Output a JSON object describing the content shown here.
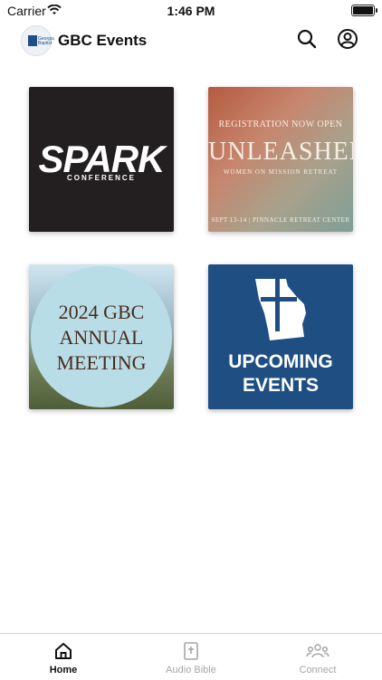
{
  "status": {
    "carrier": "Carrier",
    "time": "1:46 PM"
  },
  "header": {
    "title": "GBC Events",
    "logo_text": "Georgia Baptist"
  },
  "tiles": [
    {
      "title": "SPARK",
      "subtitle": "CONFERENCE"
    },
    {
      "top": "REGISTRATION NOW OPEN",
      "title": "UNLEASHED",
      "subtitle": "WOMEN ON MISSION RETREAT",
      "date": "SEPT 13-14 | PINNACLE RETREAT CENTER"
    },
    {
      "line1": "2024 GBC",
      "line2": "ANNUAL",
      "line3": "MEETING"
    },
    {
      "line1": "UPCOMING",
      "line2": "EVENTS"
    }
  ],
  "tabs": [
    {
      "label": "Home"
    },
    {
      "label": "Audio Bible"
    },
    {
      "label": "Connect"
    }
  ]
}
